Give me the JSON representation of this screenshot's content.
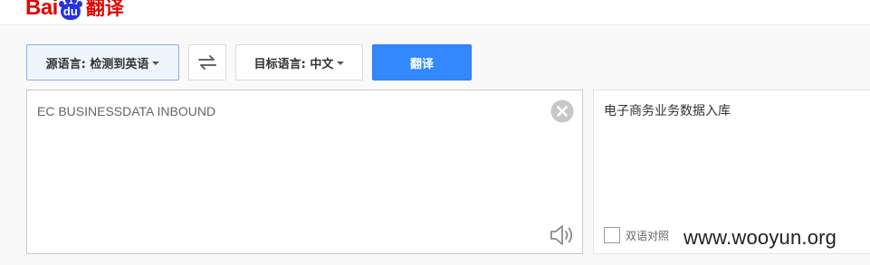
{
  "header": {
    "logo": {
      "bai": "Bai",
      "du": "du",
      "product": "翻译"
    }
  },
  "toolbar": {
    "source_language": "源语言: 检测到英语",
    "target_language": "目标语言: 中文",
    "translate_label": "翻译"
  },
  "source": {
    "text": "EC BUSINESSDATA INBOUND"
  },
  "result": {
    "text": "电子商务业务数据入库",
    "bilingual_label": "双语对照",
    "bilingual_checked": false
  },
  "watermark": "www.wooyun.org",
  "colors": {
    "brand_red": "#e10602",
    "brand_blue": "#2932e1",
    "accent": "#3388ff"
  }
}
